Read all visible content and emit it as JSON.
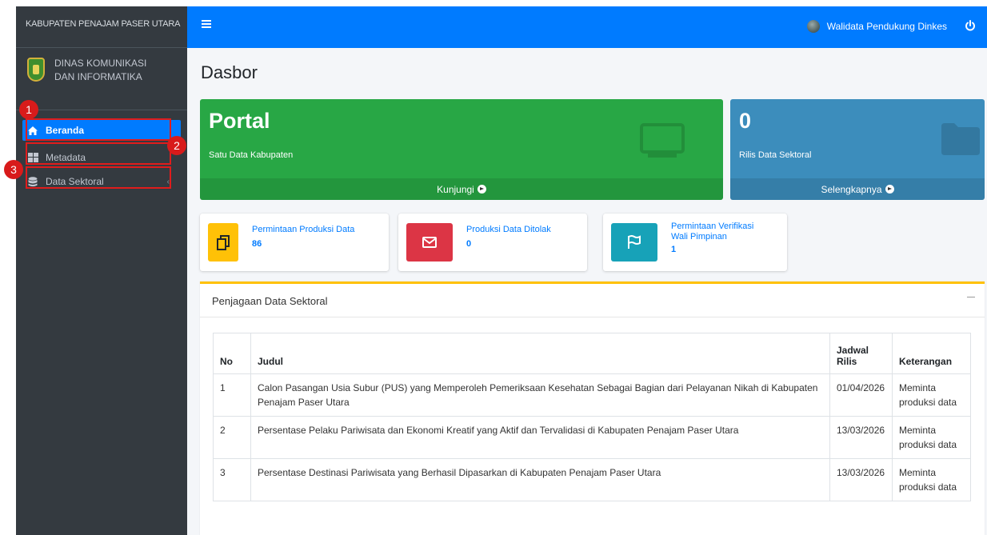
{
  "sidebar": {
    "brand": "KABUPATEN PENAJAM PASER UTARA",
    "org_line1": "DINAS KOMUNIKASI",
    "org_line2": "DAN INFORMATIKA",
    "items": [
      {
        "label": "Beranda",
        "icon": "home-icon"
      },
      {
        "label": "Metadata",
        "icon": "table-icon"
      },
      {
        "label": "Data Sektoral",
        "icon": "database-icon"
      }
    ]
  },
  "callouts": [
    "1",
    "2",
    "3"
  ],
  "topbar": {
    "user_name": "Walidata Pendukung Dinkes"
  },
  "page_title": "Dasbor",
  "portal_box": {
    "title": "Portal",
    "subtitle": "Satu Data Kabupaten",
    "link": "Kunjungi"
  },
  "rilis_box": {
    "count": "0",
    "subtitle": "Rilis Data Sektoral",
    "link": "Selengkapnya"
  },
  "info_boxes": [
    {
      "label": "Permintaan Produksi Data",
      "value": "86",
      "color": "#ffc107",
      "icon": "copy-icon"
    },
    {
      "label": "Produksi Data Ditolak",
      "value": "0",
      "color": "#dc3545",
      "icon": "envelope-icon"
    },
    {
      "label_line1": "Permintaan Verifikasi",
      "label_line2": "Wali Pimpinan",
      "value": "1",
      "color": "#17a2b8",
      "icon": "flag-icon"
    }
  ],
  "card": {
    "title": "Penjagaan Data Sektoral",
    "columns": {
      "no": "No",
      "judul": "Judul",
      "jadwal_line1": "Jadwal",
      "jadwal_line2": "Rilis",
      "keterangan": "Keterangan"
    },
    "rows": [
      {
        "no": "1",
        "judul": "Calon Pasangan Usia Subur (PUS) yang Memperoleh Pemeriksaan Kesehatan Sebagai Bagian dari Pelayanan Nikah di Kabupaten Penajam Paser Utara",
        "jadwal": "01/04/2026",
        "keterangan": "Meminta produksi data"
      },
      {
        "no": "2",
        "judul": "Persentase Pelaku Pariwisata dan Ekonomi Kreatif yang Aktif dan Tervalidasi di Kabupaten Penajam Paser Utara",
        "jadwal": "13/03/2026",
        "keterangan": "Meminta produksi data"
      },
      {
        "no": "3",
        "judul": "Persentase Destinasi Pariwisata yang Berhasil Dipasarkan di Kabupaten Penajam Paser Utara",
        "jadwal": "13/03/2026",
        "keterangan": "Meminta produksi data"
      }
    ]
  },
  "colors": {
    "sidebar_bg": "#343a40",
    "primary": "#007bff",
    "green": "#28a745",
    "blue_box": "#3c8dbc",
    "callout": "#d81b1b"
  }
}
